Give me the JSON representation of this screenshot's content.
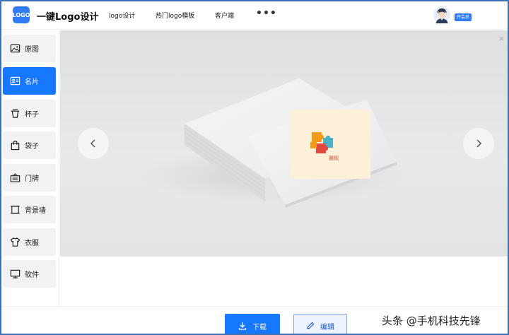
{
  "header": {
    "logo_mark": "LOGO",
    "brand": "一键Logo设计",
    "nav": [
      "logo设计",
      "热门logo模板",
      "客户端"
    ],
    "more": "•••",
    "member_badge": "开会员"
  },
  "sidebar": {
    "items": [
      {
        "label": "原图",
        "icon": "image-icon",
        "active": false
      },
      {
        "label": "名片",
        "icon": "business-card-icon",
        "active": true
      },
      {
        "label": "杯子",
        "icon": "cup-icon",
        "active": false
      },
      {
        "label": "袋子",
        "icon": "bag-icon",
        "active": false
      },
      {
        "label": "门牌",
        "icon": "door-sign-icon",
        "active": false
      },
      {
        "label": "背景墙",
        "icon": "backdrop-icon",
        "active": false
      },
      {
        "label": "衣服",
        "icon": "tshirt-icon",
        "active": false
      },
      {
        "label": "软件",
        "icon": "monitor-icon",
        "active": false
      }
    ]
  },
  "preview": {
    "close": "×",
    "card_logo_text": "雅规",
    "colors": {
      "stage_bg": "#e3e4e6",
      "card_label_bg": "#fdf0d8",
      "brand_text": "#d0453a"
    }
  },
  "actions": {
    "download": "下载",
    "edit": "编辑"
  },
  "watermark": "头条 @手机科技先锋",
  "colors": {
    "accent": "#1677ff",
    "frame_border": "#3d6fb4"
  }
}
